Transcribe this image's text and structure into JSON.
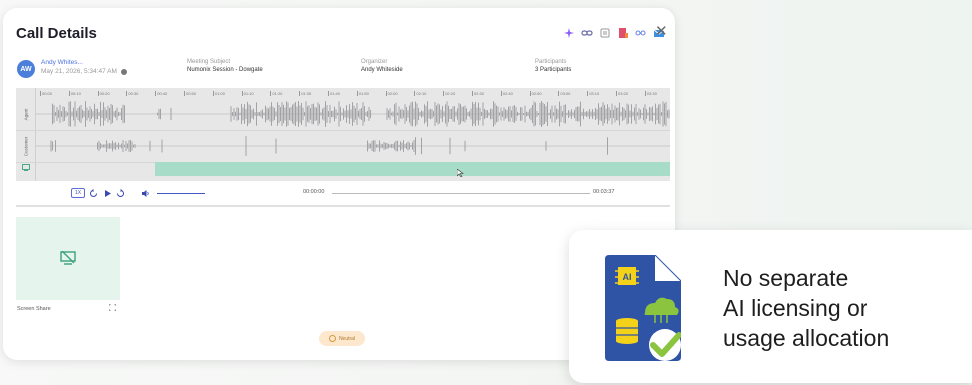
{
  "header": {
    "title": "Call Details"
  },
  "call": {
    "avatar_initials": "AW",
    "user_name": "Andy Whites...",
    "date": "May 21, 2026, 5:34:47 AM",
    "meeting_subject_label": "Meeting Subject",
    "meeting_subject": "Numonix Session - Dowgate",
    "organizer_label": "Organizer",
    "organizer": "Andy Whiteside",
    "participants_label": "Participants",
    "participants": "3 Participants"
  },
  "tracks": {
    "agent_label": "Agent",
    "customer_label": "Customer",
    "timeline_ticks": [
      "00:00",
      "00:10",
      "00:20",
      "00:30",
      "00:40",
      "00:50",
      "01:00",
      "01:10",
      "01:20",
      "01:30",
      "01:40",
      "01:50",
      "02:00",
      "02:10",
      "02:20",
      "02:30",
      "02:40",
      "02:50",
      "03:00",
      "03:10",
      "03:20",
      "03:30"
    ]
  },
  "player": {
    "speed": "1X",
    "current_time": "00:00:00",
    "total_time": "00:03:37"
  },
  "screen_share": {
    "label": "Screen Share"
  },
  "sentiment": {
    "label": "Neutral"
  },
  "card": {
    "lines": [
      "No separate",
      "AI licensing or",
      "usage allocation"
    ]
  },
  "icons": {
    "ai_sparkle": "sparkle-icon",
    "link": "link-icon",
    "screen_off": "screen-off-icon"
  },
  "colors": {
    "accent": "#4d6fe0",
    "screen_share_bar": "#a6dcc8",
    "card_icon_blue": "#2f54a6",
    "check_green": "#8bc53f"
  }
}
